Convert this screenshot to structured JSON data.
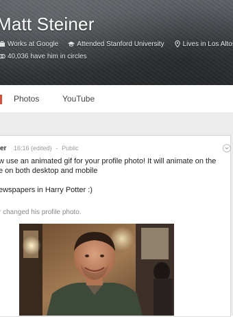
{
  "profile": {
    "name": "Matt Steiner",
    "work": "Works at Google",
    "education": "Attended Stanford University",
    "location": "Lives in Los Altos",
    "circles": "40,036 have him in circles"
  },
  "tabs": [
    {
      "label": "Photos"
    },
    {
      "label": "YouTube"
    }
  ],
  "post": {
    "author": "er",
    "time": "16:16 (edited)",
    "separator": "-",
    "visibility": "Public",
    "line1": "w use an animated gif for your profile photo!  It will animate on the",
    "line2": "e on both desktop and mobile",
    "line3": "ewspapers in Harry Potter :)",
    "shared_text": "r changed his profile photo."
  },
  "icons": {
    "work": "briefcase-icon",
    "education": "graduation-cap-icon",
    "location": "location-pin-icon",
    "circles": "circles-icon",
    "menu": "chevron-down-icon"
  }
}
